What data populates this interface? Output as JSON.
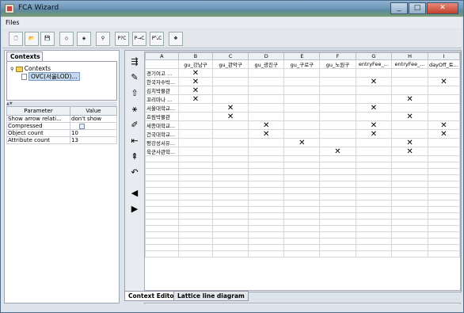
{
  "window": {
    "title": "FCA Wizard"
  },
  "menu": {
    "files": "Files"
  },
  "toolbar": [
    {
      "name": "new-context-icon",
      "glyph": "🗋"
    },
    {
      "name": "open-context-icon",
      "glyph": "📂"
    },
    {
      "name": "save-context-icon",
      "glyph": "💾"
    },
    {
      "name": "lattice-icon",
      "glyph": "◇"
    },
    {
      "name": "lattice-alt-icon",
      "glyph": "◈"
    },
    {
      "name": "tree-icon",
      "glyph": "⚲"
    },
    {
      "name": "p-c-icon",
      "glyph": "P?C"
    },
    {
      "name": "p-arrow-c-icon",
      "glyph": "P→C"
    },
    {
      "name": "p-c-alt-icon",
      "glyph": "P⤡C"
    },
    {
      "name": "graph-icon",
      "glyph": "❖"
    }
  ],
  "left": {
    "tab": "Contexts",
    "tree_root": "Contexts",
    "tree_child": "OVC(서울LOD)...",
    "param_header": {
      "parameter": "Parameter",
      "value": "Value"
    },
    "params": [
      {
        "name": "Show arrow relati...",
        "value": "don't show"
      },
      {
        "name": "Compressed",
        "value": ""
      },
      {
        "name": "Object count",
        "value": "10"
      },
      {
        "name": "Attribute count",
        "value": "13"
      }
    ]
  },
  "grid": {
    "columns": [
      "A",
      "B",
      "C",
      "D",
      "E",
      "F",
      "G",
      "H",
      "I"
    ],
    "attributes": [
      "",
      "gu_강남구",
      "gu_관악구",
      "gu_광진구",
      "gu_구로구",
      "gu_노원구",
      "entryFee_...",
      "entryFee_...",
      "dayOff_토..."
    ],
    "objects": [
      {
        "name": "경기여고 ...",
        "crosses": [
          1
        ]
      },
      {
        "name": "한국자수박...",
        "crosses": [
          1,
          6,
          8
        ]
      },
      {
        "name": "김치박물관",
        "crosses": [
          1
        ]
      },
      {
        "name": "꼬리마나 ...",
        "crosses": [
          1,
          7
        ]
      },
      {
        "name": "서울대학교...",
        "crosses": [
          2,
          6
        ]
      },
      {
        "name": "호림박물관",
        "crosses": [
          2,
          7
        ]
      },
      {
        "name": "세종대학교...",
        "crosses": [
          3,
          6,
          8
        ]
      },
      {
        "name": "건국대학교...",
        "crosses": [
          3,
          6,
          8
        ]
      },
      {
        "name": "평강성서유...",
        "crosses": [
          4,
          7
        ]
      },
      {
        "name": "육군사관학...",
        "crosses": [
          5,
          7
        ]
      }
    ]
  },
  "vtools": [
    {
      "name": "add-attribute-icon",
      "glyph": "⇶"
    },
    {
      "name": "add-object-icon",
      "glyph": "✎"
    },
    {
      "name": "move-up-icon",
      "glyph": "⇧"
    },
    {
      "name": "split-icon",
      "glyph": "⚹"
    },
    {
      "name": "edit-icon",
      "glyph": "✐"
    },
    {
      "name": "insert-left-icon",
      "glyph": "⇤"
    },
    {
      "name": "insert-top-icon",
      "glyph": "⇞"
    },
    {
      "name": "undo-icon",
      "glyph": "↶"
    },
    {
      "name": "back-icon",
      "glyph": "◀"
    },
    {
      "name": "forward-icon",
      "glyph": "▶"
    }
  ],
  "bottom_tabs": {
    "editor": "Context Editor",
    "lattice": "Lattice line diagram"
  }
}
